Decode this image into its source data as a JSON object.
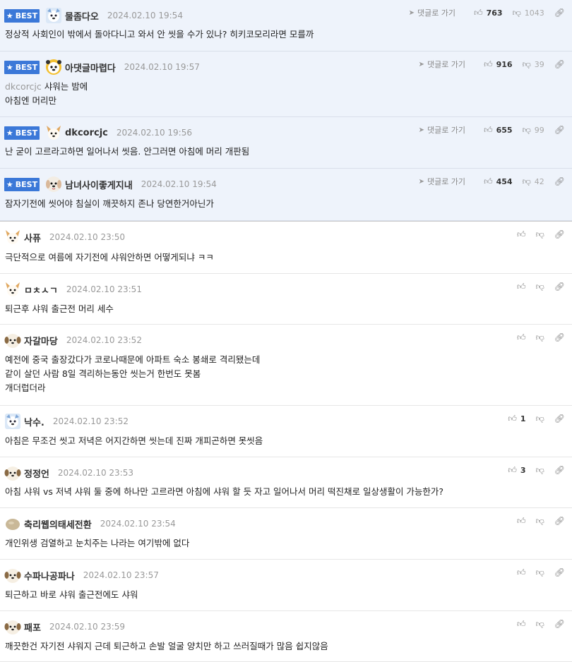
{
  "labels": {
    "best": "BEST",
    "goto": "댓글로 가기"
  },
  "comments": [
    {
      "best": true,
      "avatar": "avatar-blue-icon",
      "nick": "물좀다오",
      "date": "2024.02.10 19:54",
      "up": "763",
      "down": "1043",
      "lines": [
        "정상적 사회인이 밖에서 돌아다니고 와서 안 씻을 수가 있나? 히키코모리라면 모를까"
      ]
    },
    {
      "best": true,
      "avatar": "avatar-dog-bear-icon",
      "nick": "아댓글마렵다",
      "date": "2024.02.10 19:57",
      "up": "916",
      "down": "39",
      "mention": "dkcorcjc",
      "lines": [
        "샤워는 밤에",
        "아침엔 머리만"
      ]
    },
    {
      "best": true,
      "avatar": "avatar-dog-ear-icon",
      "nick": "dkcorcjc",
      "date": "2024.02.10 19:56",
      "up": "655",
      "down": "99",
      "lines": [
        "난 굳이 고르라고하면 일어나서 씻음. 안그러면 아침에 머리 개판됨"
      ]
    },
    {
      "best": true,
      "avatar": "avatar-dog-white-icon",
      "nick": "남녀사이좋게지내",
      "date": "2024.02.10 19:54",
      "up": "454",
      "down": "42",
      "lines": [
        "잠자기전에 씻어야 침실이 깨끗하지 존나 당연한거아닌가"
      ]
    },
    {
      "best": false,
      "avatar": "avatar-dog-ear-icon",
      "nick": "사퓨",
      "date": "2024.02.10 23:50",
      "up": "",
      "lines": [
        "극단적으로 여름에 자기전에 샤워안하면 어떻게되냐 ㅋㅋ"
      ]
    },
    {
      "best": false,
      "avatar": "avatar-dog-ear-icon",
      "nick": "ㅁㅊㅅㄱ",
      "date": "2024.02.10 23:51",
      "up": "",
      "lines": [
        "퇴근후 샤워 출근전 머리 세수"
      ]
    },
    {
      "best": false,
      "avatar": "avatar-dog-round-icon",
      "nick": "자갈마당",
      "date": "2024.02.10 23:52",
      "up": "",
      "lines": [
        "예전에 중국 출장갔다가 코로나때문에 아파트 숙소 봉쇄로 격리됐는데",
        "같이 살던 사람 8일 격리하는동안 씻는거 한번도 못봄",
        "개더럽더라"
      ]
    },
    {
      "best": false,
      "avatar": "avatar-blue-icon",
      "nick": "낙수.",
      "date": "2024.02.10 23:52",
      "up": "1",
      "lines": [
        "아침은 무조건 씻고 저녁은 어지간하면 씻는데 진짜 개피곤하면 못씻음"
      ]
    },
    {
      "best": false,
      "avatar": "avatar-dog-round-icon",
      "nick": "정정언",
      "date": "2024.02.10 23:53",
      "up": "3",
      "lines": [
        "아침 샤워 vs 저녁 샤워 둘 중에 하나만 고르라면 아침에 샤워 할 듯 자고 일어나서 머리 떡진채로 일상생활이 가능한가?"
      ]
    },
    {
      "best": false,
      "avatar": "avatar-stone-icon",
      "nick": "축리웹의태세전환",
      "date": "2024.02.10 23:54",
      "up": "",
      "lines": [
        "개인위생 검열하고 눈치주는 나라는 여기밖에 없다"
      ]
    },
    {
      "best": false,
      "avatar": "avatar-dog-round-icon",
      "nick": "수파나공파나",
      "date": "2024.02.10 23:57",
      "up": "",
      "lines": [
        "퇴근하고 바로 샤워 출근전에도 샤워"
      ]
    },
    {
      "best": false,
      "avatar": "avatar-dog-round-icon",
      "nick": "패포",
      "date": "2024.02.10 23:59",
      "up": "",
      "lines": [
        "깨끗한건 자기전 샤워지 근데 퇴근하고 손발 얼굴 양치만 하고 쓰러질때가 많음 쉽지않음"
      ]
    }
  ]
}
